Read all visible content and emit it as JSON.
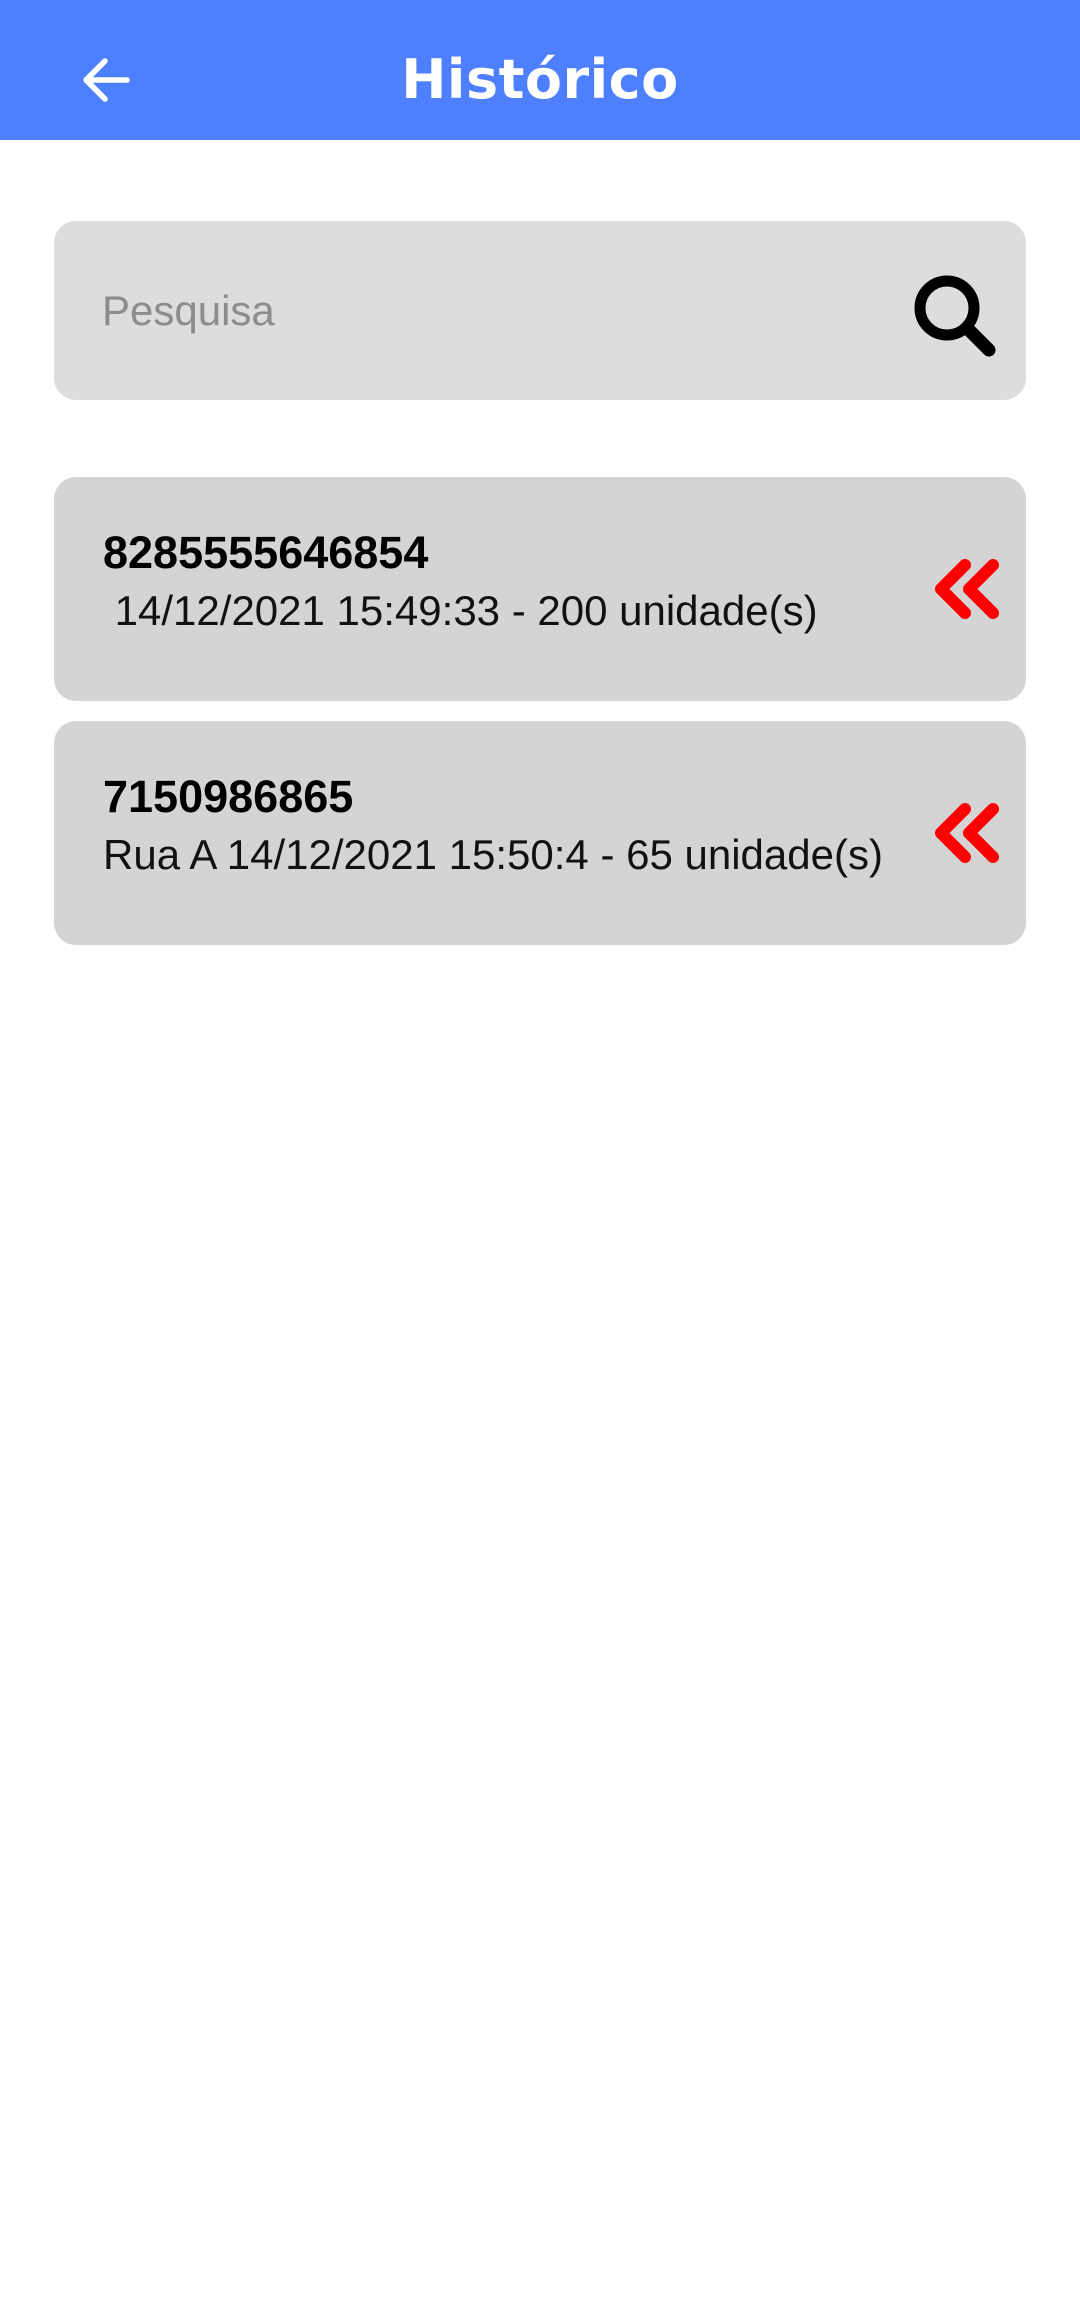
{
  "app_bar": {
    "title": "Histórico",
    "back_icon": "arrow-left-icon",
    "background_color": "#4d7fff"
  },
  "search": {
    "placeholder": "Pesquisa",
    "value": "",
    "icon": "search-icon"
  },
  "history": {
    "items": [
      {
        "code": "8285555646854",
        "detail": " 14/12/2021 15:49:33 - 200 unidade(s)",
        "action_icon": "double-chevron-left-icon"
      },
      {
        "code": "7150986865",
        "detail": "Rua A 14/12/2021 15:50:4 - 65 unidade(s)",
        "action_icon": "double-chevron-left-icon"
      }
    ]
  },
  "colors": {
    "accent": "#4d7fff",
    "item_background": "#d4d4d4",
    "search_background": "#dddddd",
    "action_icon": "#ff0000"
  }
}
